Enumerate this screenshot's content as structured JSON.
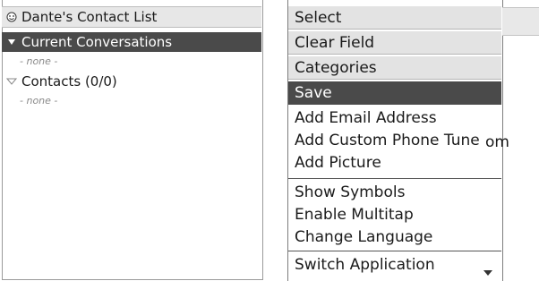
{
  "contact_list": {
    "title": "Dante's Contact List",
    "groups": [
      {
        "label": "Current Conversations",
        "empty_text": "- none -"
      },
      {
        "label": "Contacts (0/0)",
        "empty_text": "- none -"
      }
    ]
  },
  "menu": {
    "items": [
      {
        "label": "Select"
      },
      {
        "label": "Clear Field"
      },
      {
        "label": "Categories"
      },
      {
        "label": "Save"
      },
      {
        "label": "Add Email Address"
      },
      {
        "label": "Add Custom Phone Tune"
      },
      {
        "label": "Add Picture"
      },
      {
        "label": "Show Symbols"
      },
      {
        "label": "Enable Multitap"
      },
      {
        "label": "Change Language"
      },
      {
        "label": "Switch Application"
      }
    ],
    "selected": "Save",
    "overflow_text": "om"
  },
  "icons": {
    "title_icon": "smiley-icon",
    "current_icon": "expanded-arrow-icon",
    "contacts_icon": "collapsed-arrow-icon",
    "scroll_icon": "scroll-down-icon"
  },
  "colors": {
    "highlight": "#4a4a4a",
    "shaded_row": "#e3e3e3"
  }
}
